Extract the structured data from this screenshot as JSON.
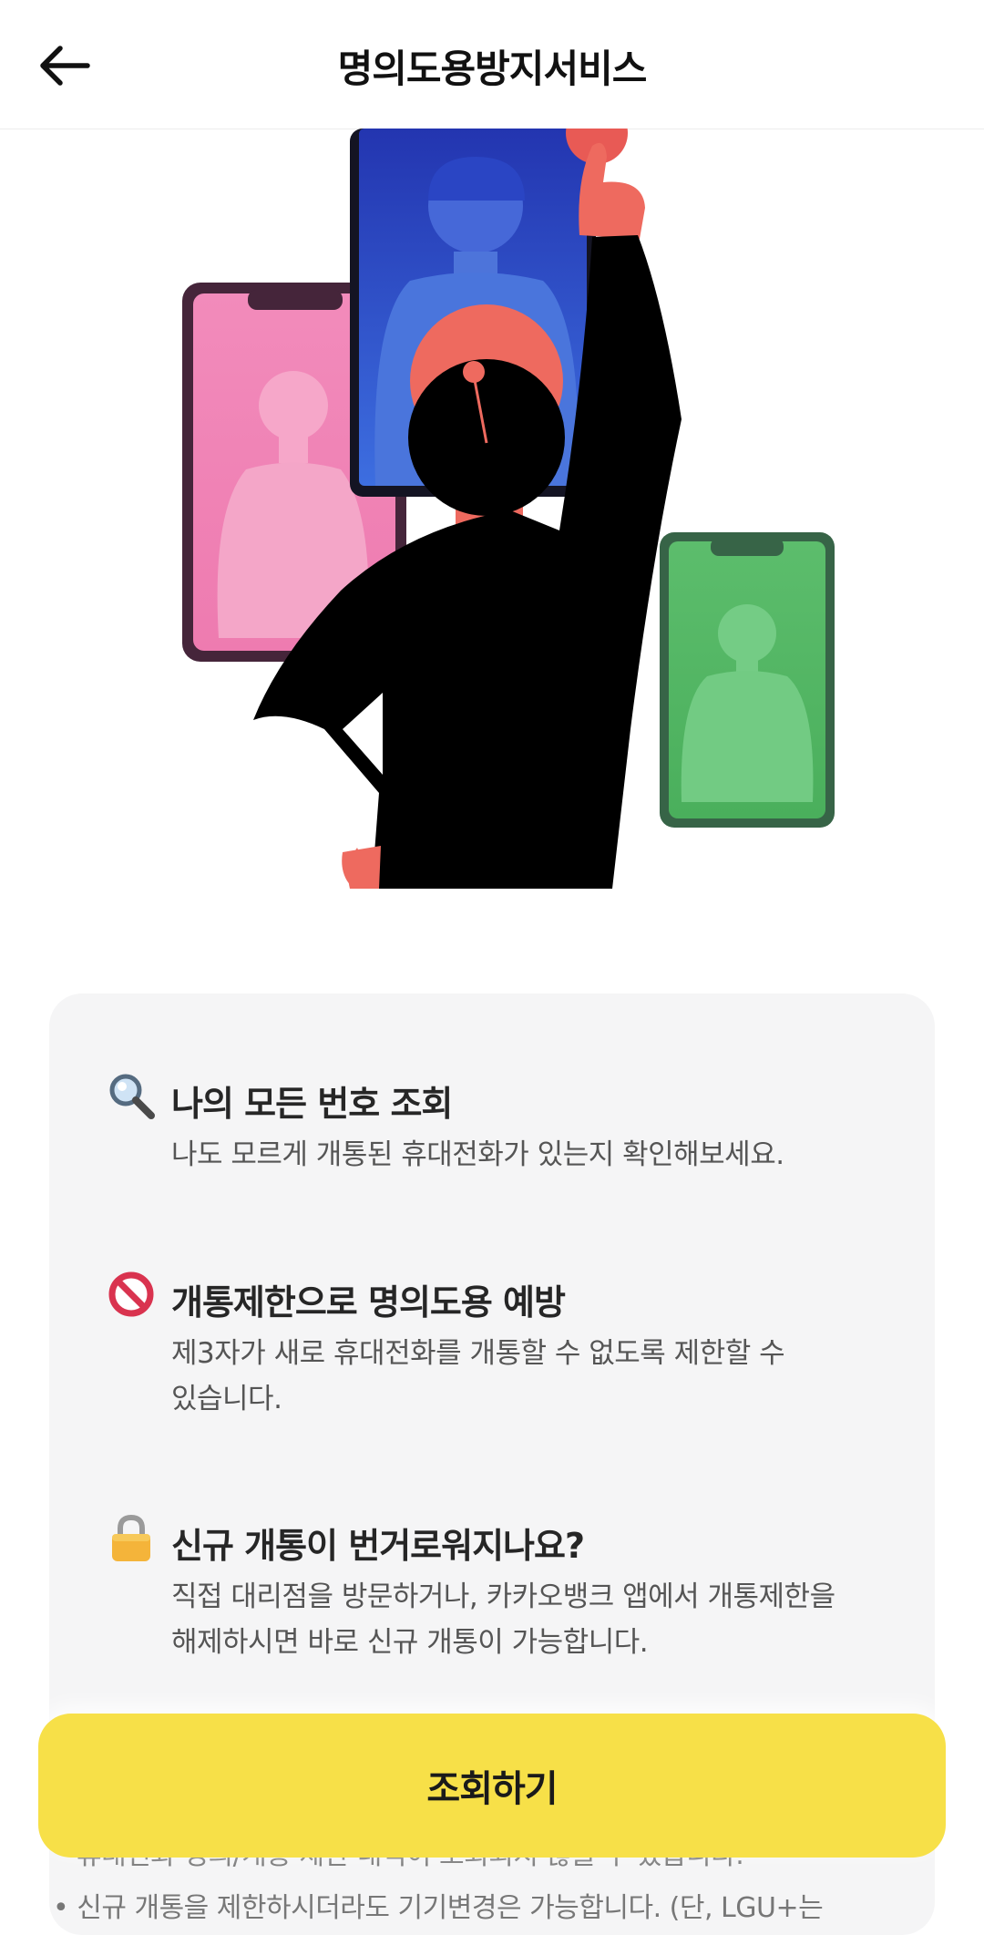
{
  "header": {
    "title": "명의도용방지서비스",
    "back_icon": "arrow-left-icon"
  },
  "illustration": {
    "description_icon": "person-with-phones-illustration",
    "colors": {
      "pink_phone": "#f083b4",
      "blue_phone": "#2f55d4",
      "green_phone": "#58b867",
      "skin": "#ee6a5f",
      "silhouette": "#000000"
    }
  },
  "features": [
    {
      "icon": "magnifier-icon",
      "title": "나의 모든 번호 조회",
      "desc": [
        "나도 모르게 개통된 휴대전화가 있는지 확인해보세요."
      ]
    },
    {
      "icon": "prohibited-icon",
      "title": "개통제한으로 명의도용 예방",
      "desc": [
        "제3자가 새로 휴대전화를 개통할 수 없도록 제한할 수",
        "있습니다."
      ]
    },
    {
      "icon": "lock-icon",
      "title": "신규 개통이 번거로워지나요?",
      "desc": [
        "직접 대리점을 방문하거나, 카카오뱅크 앱에서 개통제한을",
        "해제하시면 바로 신규 개통이 가능합니다."
      ]
    }
  ],
  "notes": [
    "휴대전화 명의/개통 제한 내역이 조회되지 않을 수 있습니다.",
    "• 신규 개통을 제한하시더라도 기기변경은 가능합니다. (단, LGU+는"
  ],
  "cta": {
    "label": "조회하기",
    "color": "#f7e048"
  }
}
